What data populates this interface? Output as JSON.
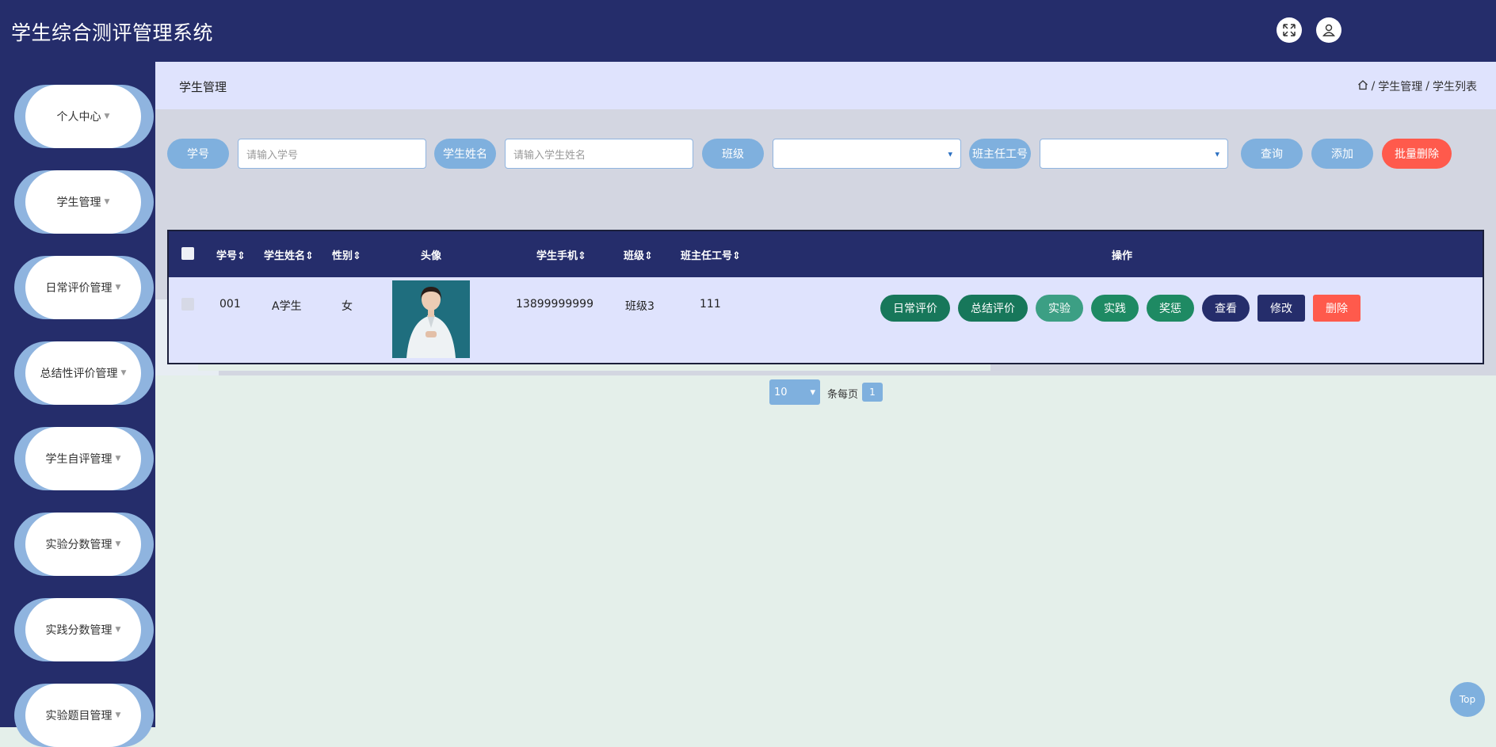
{
  "app": {
    "title": "学生综合测评管理系统"
  },
  "header_icons": {
    "fullscreen": "fullscreen-icon",
    "user": "user-icon"
  },
  "sidebar": {
    "items": [
      {
        "label": "个人中心"
      },
      {
        "label": "学生管理"
      },
      {
        "label": "日常评价管理"
      },
      {
        "label": "总结性评价管理"
      },
      {
        "label": "学生自评管理"
      },
      {
        "label": "实验分数管理"
      },
      {
        "label": "实践分数管理"
      },
      {
        "label": "实验题目管理"
      }
    ]
  },
  "page": {
    "title": "学生管理",
    "breadcrumb": {
      "sep": "/",
      "items": [
        "学生管理",
        "学生列表"
      ]
    }
  },
  "search": {
    "student_no_label": "学号",
    "student_no_placeholder": "请输入学号",
    "name_label": "学生姓名",
    "name_placeholder": "请输入学生姓名",
    "class_label": "班级",
    "class_value": "",
    "teacher_label": "班主任工号",
    "teacher_value": "",
    "query": "查询",
    "add": "添加",
    "batch_delete": "批量删除"
  },
  "table": {
    "headers": {
      "student_no": "学号",
      "name": "学生姓名",
      "gender": "性别",
      "avatar": "头像",
      "phone": "学生手机",
      "class": "班级",
      "teacher_no": "班主任工号",
      "actions": "操作"
    },
    "rows": [
      {
        "student_no": "001",
        "name": "A学生",
        "gender": "女",
        "phone": "13899999999",
        "class": "班级3",
        "teacher_no": "111"
      }
    ],
    "actions": [
      "日常评价",
      "总结评价",
      "实验",
      "实践",
      "奖惩",
      "查看",
      "修改",
      "删除"
    ]
  },
  "pagination": {
    "page_size": "10",
    "per_page_label": "条每页",
    "current_page": "1"
  },
  "back_to_top": "Top",
  "colors": {
    "navy": "#252d6b",
    "light_blue": "#7fb0de",
    "green": "#17775a",
    "red": "#ff5a4c",
    "header_bg": "#dfe3fd"
  }
}
